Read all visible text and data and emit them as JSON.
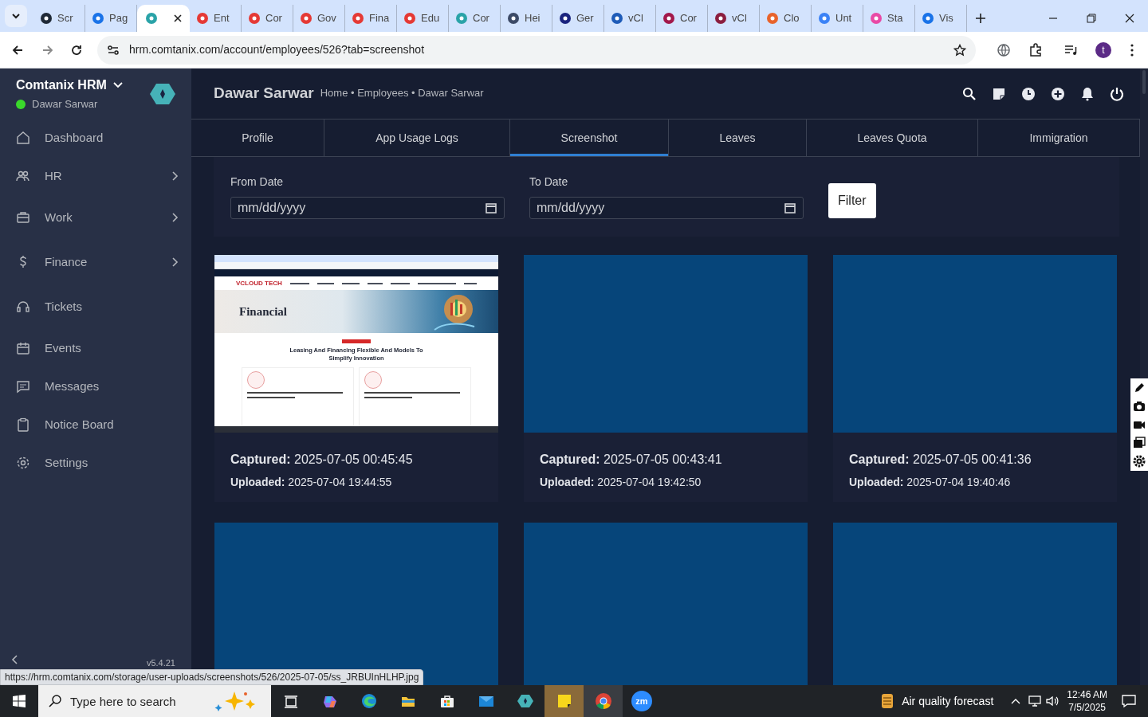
{
  "browser": {
    "tabs": [
      {
        "label": "Scr",
        "selected": false
      },
      {
        "label": "Pag",
        "selected": false
      },
      {
        "selected": true
      },
      {
        "label": "Ent",
        "selected": false
      },
      {
        "label": "Cor",
        "selected": false
      },
      {
        "label": "Gov",
        "selected": false
      },
      {
        "label": "Fina",
        "selected": false
      },
      {
        "label": "Edu",
        "selected": false
      },
      {
        "label": "Cor",
        "selected": false
      },
      {
        "label": "Hei",
        "selected": false
      },
      {
        "label": "Ger",
        "selected": false
      },
      {
        "label": "vCl",
        "selected": false
      },
      {
        "label": "Cor",
        "selected": false
      },
      {
        "label": "vCl",
        "selected": false
      },
      {
        "label": "Clo",
        "selected": false
      },
      {
        "label": "Unt",
        "selected": false
      },
      {
        "label": "Sta",
        "selected": false
      },
      {
        "label": "Vis",
        "selected": false
      }
    ],
    "address": "hrm.comtanix.com/account/employees/526?tab=screenshot",
    "profile_initial": "t"
  },
  "sidebar": {
    "brand": "Comtanix HRM",
    "user": "Dawar Sarwar",
    "online": true,
    "items": [
      {
        "label": "Dashboard",
        "expandable": false
      },
      {
        "label": "HR",
        "expandable": true
      },
      {
        "label": "Work",
        "expandable": true
      },
      {
        "label": "Finance",
        "expandable": true
      },
      {
        "label": "Tickets",
        "expandable": false
      },
      {
        "label": "Events",
        "expandable": false
      },
      {
        "label": "Messages",
        "expandable": false
      },
      {
        "label": "Notice Board",
        "expandable": false
      },
      {
        "label": "Settings",
        "expandable": false
      }
    ],
    "version": "v5.4.21"
  },
  "header": {
    "title": "Dawar Sarwar",
    "breadcrumb": "Home • Employees • Dawar Sarwar"
  },
  "tabs": [
    {
      "label": "Profile",
      "selected": false
    },
    {
      "label": "App Usage Logs",
      "selected": false
    },
    {
      "label": "Screenshot",
      "selected": true
    },
    {
      "label": "Leaves",
      "selected": false
    },
    {
      "label": "Leaves Quota",
      "selected": false
    },
    {
      "label": "Immigration",
      "selected": false
    }
  ],
  "filter": {
    "from_label": "From Date",
    "from_placeholder": "mm/dd/yyyy",
    "to_label": "To Date",
    "to_placeholder": "mm/dd/yyyy",
    "button": "Filter"
  },
  "screenshots": [
    {
      "kind": "captured",
      "captured": "**Captured:** 2025-07-05 00:45:45",
      "uploaded": "**Uploaded:** 2025-07-04 19:44:55",
      "preview": {
        "logo": "VCLOUD TECH",
        "hero_title": "Financial",
        "heading": "Leasing And Financing Flexible And Models To Simplify Innovation"
      }
    },
    {
      "kind": "captured",
      "captured": "**Captured:** 2025-07-05 00:43:41",
      "uploaded": "**Uploaded:** 2025-07-04 19:42:50"
    },
    {
      "kind": "captured",
      "captured": "**Captured:** 2025-07-05 00:41:36",
      "uploaded": "**Uploaded:** 2025-07-04 19:40:46"
    },
    {
      "kind": "captured"
    },
    {
      "kind": "captured"
    },
    {
      "kind": "captured"
    }
  ],
  "status_url": "https://hrm.comtanix.com/storage/user-uploads/screenshots/526/2025-07-05/ss_JRBUInHLHP.jpg",
  "taskbar": {
    "search_placeholder": "Type here to search",
    "zoom_badge": "zm",
    "weather": "Air quality forecast",
    "time": "12:46 AM",
    "date": "7/5/2025"
  }
}
